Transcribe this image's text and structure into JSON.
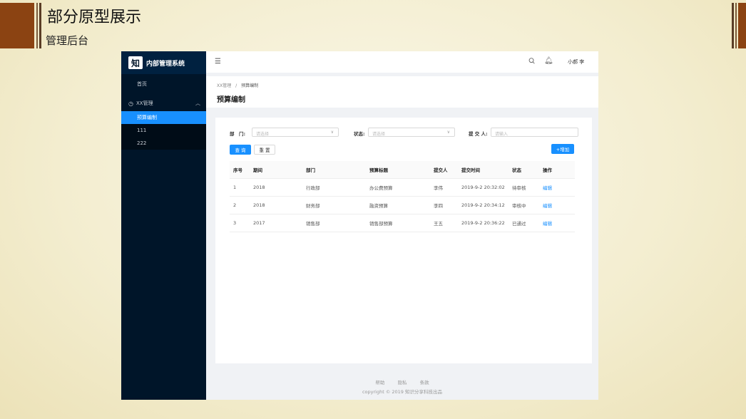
{
  "slide": {
    "title": "部分原型展示",
    "subtitle": "管理后台"
  },
  "app": {
    "logo_glyph": "知",
    "name": "内部管理系统",
    "menu": {
      "home": "首页",
      "group": "XX管理",
      "group_icon": "dashboard-icon",
      "sub_items": [
        "预算编制",
        "111",
        "222"
      ]
    },
    "header": {
      "fold_icon": "menu-fold-icon",
      "user": "小郝 李"
    },
    "breadcrumb": {
      "parent": "XX管理",
      "separator": "/",
      "current": "预算编制"
    },
    "page_title": "预算编制",
    "filters": {
      "dept_label": "部　门:",
      "dept_placeholder": "请选择",
      "status_label": "状态:",
      "status_placeholder": "请选择",
      "submitter_label": "提 交 人:",
      "submitter_placeholder": "请输入"
    },
    "buttons": {
      "query": "查 询",
      "reset": "重 置",
      "add": "+增加"
    },
    "table": {
      "columns": [
        "序号",
        "期间",
        "部门",
        "预算标题",
        "提交人",
        "提交时间",
        "状态",
        "操作"
      ],
      "rows": [
        [
          "1",
          "2018",
          "行政部",
          "办公费预算",
          "李伟",
          "2019-9-2 20:32:02",
          "待审核",
          "编辑"
        ],
        [
          "2",
          "2018",
          "财务部",
          "融资预算",
          "李四",
          "2019-9-2 20:34:12",
          "审核中",
          "编辑"
        ],
        [
          "3",
          "2017",
          "销售部",
          "销售部预算",
          "王五",
          "2019-9-2 20:36:22",
          "已通过",
          "编辑"
        ]
      ]
    },
    "footer": {
      "links": [
        "帮助",
        "隐私",
        "条款"
      ],
      "copyright": "copyright © 2019 知识分享科技出品"
    }
  },
  "colors": {
    "brand": "#1890ff",
    "sidebar": "#001529",
    "accent": "#8b4312"
  }
}
